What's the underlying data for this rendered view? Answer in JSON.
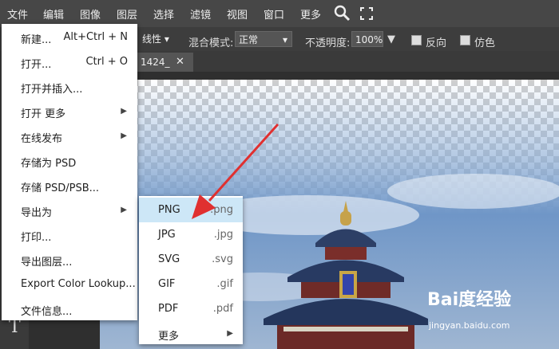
{
  "menubar": {
    "items": [
      "文件",
      "编辑",
      "图像",
      "图层",
      "选择",
      "滤镜",
      "视图",
      "窗口",
      "更多"
    ],
    "search_icon": "search-icon",
    "fullscreen_icon": "fullscreen-icon"
  },
  "options": {
    "interp_value": "线性",
    "blend_label": "混合模式:",
    "blend_value": "正常",
    "opacity_label": "不透明度:",
    "opacity_value": "100%",
    "reverse_label": "反向",
    "dither_label": "仿色"
  },
  "tab": {
    "title": "1424_",
    "close": "✕"
  },
  "file_menu": [
    {
      "label": "新建...",
      "shortcut": "Alt+Ctrl + N"
    },
    {
      "label": "打开...",
      "shortcut": "Ctrl + O"
    },
    {
      "label": "打开并插入...",
      "shortcut": ""
    },
    {
      "label": "打开 更多",
      "shortcut": "",
      "submenu": true
    },
    {
      "label": "在线发布",
      "shortcut": "",
      "submenu": true
    },
    {
      "label": "存储为 PSD",
      "shortcut": ""
    },
    {
      "label": "存储 PSD/PSB...",
      "shortcut": ""
    },
    {
      "label": "导出为",
      "shortcut": "",
      "submenu": true
    },
    {
      "label": "打印...",
      "shortcut": ""
    },
    {
      "label": "导出图层...",
      "shortcut": ""
    },
    {
      "label": "Export Color Lookup...",
      "shortcut": ""
    },
    {
      "label": "文件信息...",
      "shortcut": ""
    }
  ],
  "export_submenu": [
    {
      "label": "PNG",
      "ext": ".png",
      "highlighted": true
    },
    {
      "label": "JPG",
      "ext": ".jpg"
    },
    {
      "label": "SVG",
      "ext": ".svg"
    },
    {
      "label": "GIF",
      "ext": ".gif"
    },
    {
      "label": "PDF",
      "ext": ".pdf"
    },
    {
      "label": "更多",
      "ext": "",
      "submenu": true
    }
  ],
  "watermark": {
    "brand": "Bai度经验",
    "url": "jingyan.baidu.com"
  },
  "colors": {
    "highlight": "#cde7f7",
    "arrow": "#e03030",
    "menubar": "#474747"
  }
}
